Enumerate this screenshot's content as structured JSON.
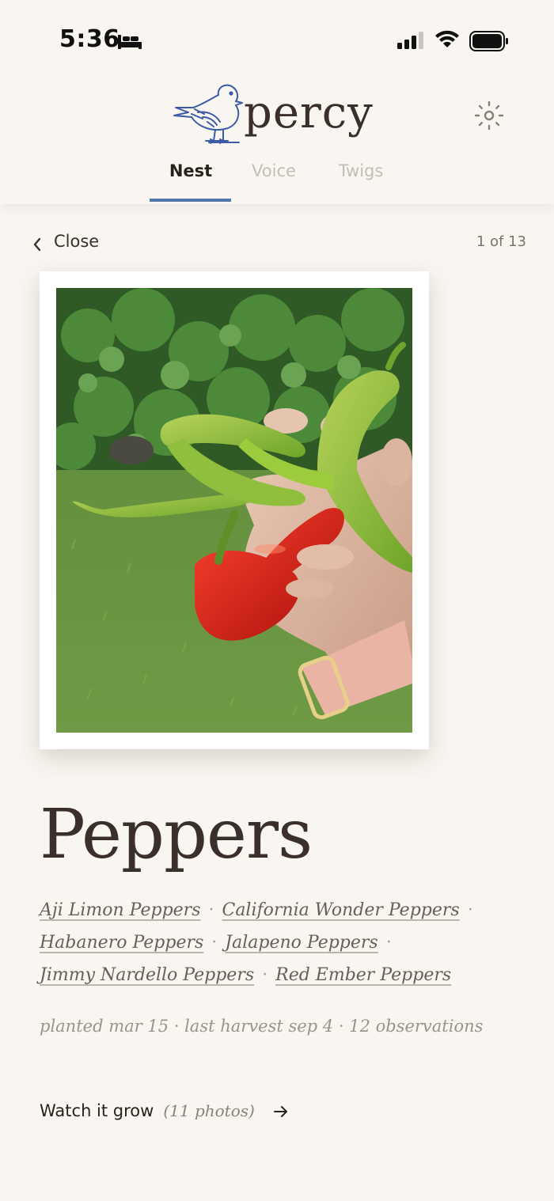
{
  "status_bar": {
    "time": "5:36",
    "icons": [
      "bed-icon",
      "signal-icon",
      "wifi-icon",
      "battery-icon"
    ]
  },
  "header": {
    "logo_text": "percy",
    "logo_icon": "bird-icon",
    "settings_icon": "sun-gear-icon",
    "tabs": [
      {
        "label": "Nest",
        "active": true
      },
      {
        "label": "Voice",
        "active": false
      },
      {
        "label": "Twigs",
        "active": false
      }
    ],
    "accent_color": "#4f77b5"
  },
  "detail": {
    "close_label": "Close",
    "counter": "1 of 13",
    "photo_description_icon": "pepper-photo",
    "title": "Peppers",
    "varieties": [
      "Aji Limon Peppers",
      "California Wonder Peppers",
      "Habanero Peppers",
      "Jalapeno Peppers",
      "Jimmy Nardello Peppers",
      "Red Ember Peppers"
    ],
    "separator": "·",
    "meta": "planted mar 15 · last harvest sep 4 · 12 observations",
    "watch_label": "Watch it grow",
    "watch_count": "(11 photos)"
  }
}
